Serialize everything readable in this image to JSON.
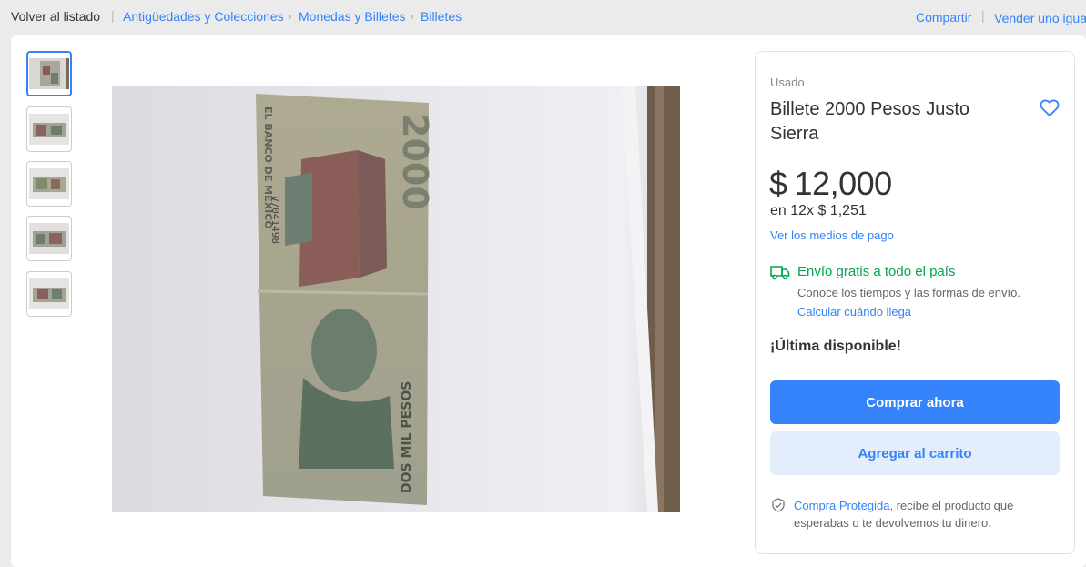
{
  "breadcrumb": {
    "back": "Volver al listado",
    "items": [
      "Antigüedades y Colecciones",
      "Monedas y Billetes",
      "Billetes"
    ]
  },
  "actions": {
    "share": "Compartir",
    "sell": "Vender uno igual"
  },
  "gallery": {
    "thumbnail_icon": "banknote-photo",
    "main_image_icon": "banknote-photo",
    "banknote_text": {
      "bank": "EL BANCO DE MÉXICO",
      "denomination": "2000",
      "words": "DOS MIL PESOS",
      "serial": "V7041498"
    }
  },
  "product": {
    "condition": "Usado",
    "title": "Billete 2000 Pesos Justo Sierra",
    "favorite_icon": "heart-icon",
    "currency": "$",
    "price": "12,000",
    "installments": "en 12x $ 1,251",
    "payment_link": "Ver los medios de pago"
  },
  "shipping": {
    "icon": "truck-icon",
    "title": "Envío gratis a todo el país",
    "subtitle": "Conoce los tiempos y las formas de envío.",
    "link": "Calcular cuándo llega"
  },
  "stock": "¡Última disponible!",
  "buttons": {
    "buy": "Comprar ahora",
    "cart": "Agregar al carrito"
  },
  "protection": {
    "icon": "shield-check-icon",
    "link": "Compra Protegida",
    "text": ", recibe el producto que esperabas o te devolvemos tu dinero."
  },
  "colors": {
    "accent": "#3483fa",
    "shipping_green": "#00a650",
    "cart_bg": "#e3edfb"
  }
}
